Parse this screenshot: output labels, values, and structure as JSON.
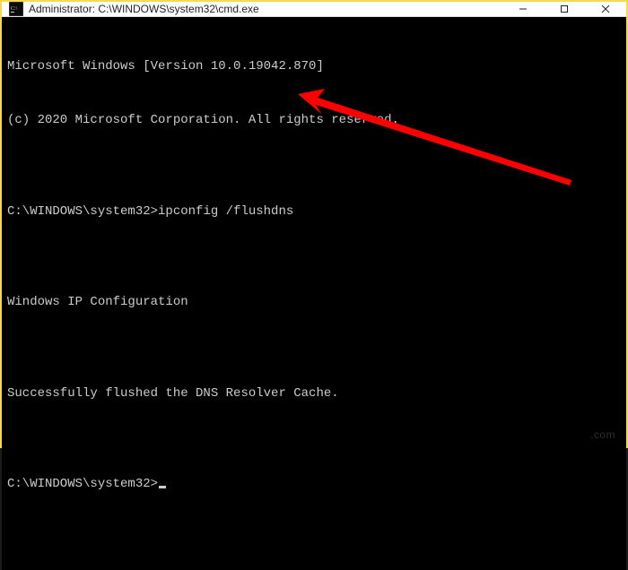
{
  "titlebar": {
    "title": "Administrator: C:\\WINDOWS\\system32\\cmd.exe",
    "minimize": "–",
    "maximize": "□",
    "close": "✕"
  },
  "terminal": {
    "line1": "Microsoft Windows [Version 10.0.19042.870]",
    "line2": "(c) 2020 Microsoft Corporation. All rights reserved.",
    "blank1": "",
    "prompt1_path": "C:\\WINDOWS\\system32>",
    "prompt1_cmd": "ipconfig /flushdns",
    "blank2": "",
    "line3": "Windows IP Configuration",
    "blank3": "",
    "line4": "Successfully flushed the DNS Resolver Cache.",
    "blank4": "",
    "prompt2_path": "C:\\WINDOWS\\system32>"
  },
  "watermark": ".com"
}
